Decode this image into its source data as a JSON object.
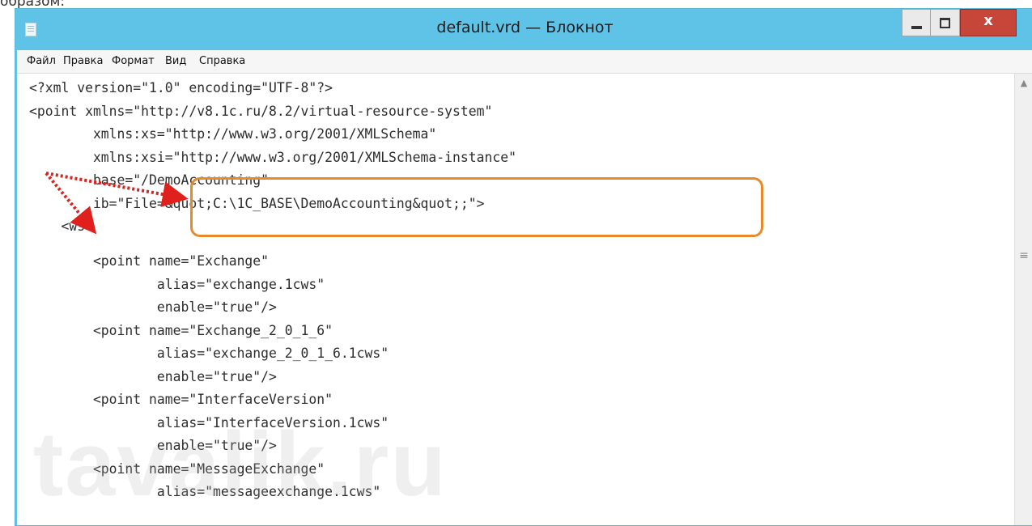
{
  "page": {
    "caption": "образом:"
  },
  "window": {
    "title": "default.vrd — Блокнот",
    "icon": "notepad-icon",
    "controls": {
      "minimize_icon": "minimize-icon",
      "maximize_icon": "maximize-icon",
      "close_label": "x"
    }
  },
  "menu": {
    "items": [
      {
        "label": "Файл"
      },
      {
        "label": "Правка"
      },
      {
        "label": "Формат"
      },
      {
        "label": "Вид"
      },
      {
        "label": "Справка"
      }
    ]
  },
  "editor": {
    "lines": [
      "<?xml version=\"1.0\" encoding=\"UTF-8\"?>",
      "<point xmlns=\"http://v8.1c.ru/8.2/virtual-resource-system\"",
      "        xmlns:xs=\"http://www.w3.org/2001/XMLSchema\"",
      "        xmlns:xsi=\"http://www.w3.org/2001/XMLSchema-instance\"",
      "        base=\"/DemoAccounting\"",
      "        ib=\"File=&quot;C:\\1C_BASE\\DemoAccounting&quot;;\">",
      "    <ws>",
      "        <point name=\"Exchange\"",
      "                alias=\"exchange.1cws\"",
      "                enable=\"true\"/>",
      "        <point name=\"Exchange_2_0_1_6\"",
      "                alias=\"exchange_2_0_1_6.1cws\"",
      "                enable=\"true\"/>",
      "        <point name=\"InterfaceVersion\"",
      "                alias=\"InterfaceVersion.1cws\"",
      "                enable=\"true\"/>",
      "        <point name=\"MessageExchange\"",
      "                alias=\"messageexchange.1cws\""
    ]
  },
  "annotation": {
    "arrow_color": "#e0201c",
    "box_color": "#e8892c"
  },
  "watermark": "tavalik.ru",
  "colors": {
    "titlebar": "#5fc3e8",
    "close": "#c7463a"
  }
}
